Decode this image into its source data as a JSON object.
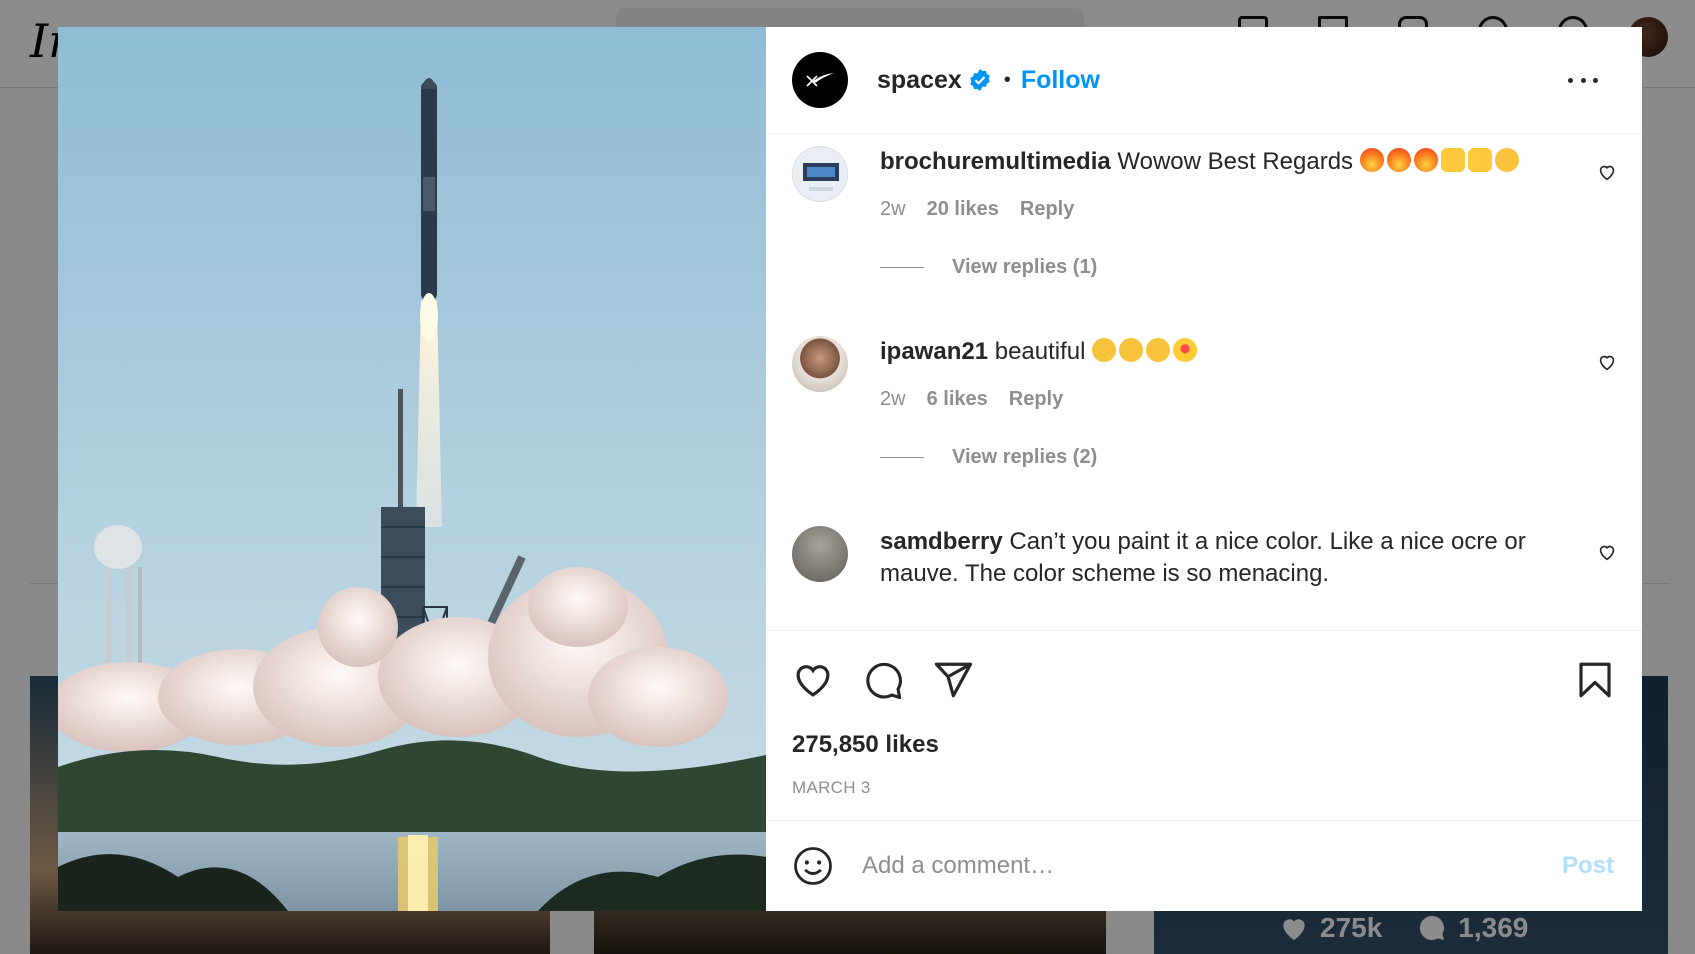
{
  "background": {
    "logo": "Ins",
    "tile_stats": {
      "likes": "275k",
      "comments": "1,369"
    }
  },
  "post": {
    "author": "spacex",
    "separator": "•",
    "follow_label": "Follow",
    "likes_text": "275,850 likes",
    "date": "MARCH 3"
  },
  "comments": [
    {
      "user": "brochuremultimedia",
      "text": "Wowow Best Regards",
      "emoji": [
        "fire",
        "fire",
        "fire",
        "raised-hands",
        "raised-hands",
        "clapping-hands"
      ],
      "time": "2w",
      "likes": "20 likes",
      "reply": "Reply",
      "view_replies": "View replies (1)"
    },
    {
      "user": "ipawan21",
      "text": "beautiful",
      "emoji": [
        "clapping-hands",
        "clapping-hands",
        "clapping-hands",
        "heart-eyes"
      ],
      "time": "2w",
      "likes": "6 likes",
      "reply": "Reply",
      "view_replies": "View replies (2)"
    },
    {
      "user": "samdberry",
      "text": "Can’t you paint it a nice color. Like a nice ocre or mauve. The color scheme is so menacing.",
      "time": "",
      "likes": "",
      "reply": ""
    }
  ],
  "add_comment": {
    "placeholder": "Add a comment…",
    "post_label": "Post"
  },
  "colors": {
    "link_blue": "#0095f6",
    "post_disabled": "#b3dffc",
    "secondary_text": "#8e8e8e"
  },
  "icons": [
    "verified-badge-icon",
    "more-options-icon",
    "heart-icon",
    "comment-icon",
    "share-icon",
    "bookmark-icon",
    "emoji-icon"
  ]
}
